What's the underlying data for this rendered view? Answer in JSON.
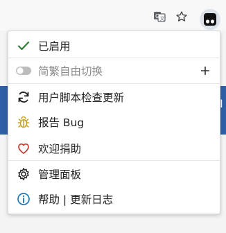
{
  "menu": {
    "items": [
      {
        "label": "已启用",
        "icon": "check-icon"
      },
      {
        "label": "简繁自由切换",
        "icon": "toggle-off-icon",
        "action_icon": "plus-icon"
      },
      {
        "label": "用户脚本检查更新",
        "icon": "refresh-icon"
      },
      {
        "label": "报告 Bug",
        "icon": "bug-icon"
      },
      {
        "label": "欢迎捐助",
        "icon": "heart-icon"
      },
      {
        "label": "管理面板",
        "icon": "gear-icon"
      },
      {
        "label": "帮助 | 更新日志",
        "icon": "info-icon"
      }
    ]
  },
  "toolbar": {
    "icons": [
      "translate-icon",
      "star-icon",
      "tampermonkey-icon"
    ]
  },
  "background": {
    "edge_letter": "I"
  },
  "colors": {
    "check": "#2e7d32",
    "bug": "#c9a227",
    "heart": "#c0392b",
    "info": "#1f7ab8",
    "accent_blue": "#2f5fa7"
  }
}
